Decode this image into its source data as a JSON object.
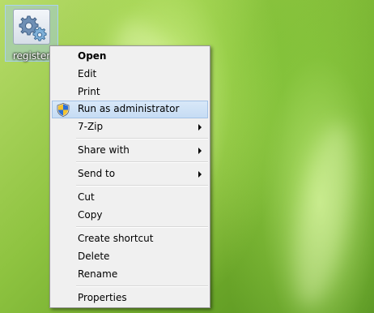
{
  "desktop": {
    "icon": {
      "label": "register",
      "icon": "gear-icon"
    }
  },
  "context_menu": {
    "items": [
      {
        "label": "Open",
        "bold": true
      },
      {
        "label": "Edit"
      },
      {
        "label": "Print"
      },
      {
        "label": "Run as administrator",
        "icon": "uac-shield-icon",
        "highlighted": true
      },
      {
        "label": "7-Zip",
        "submenu": true
      },
      {
        "label": "Share with",
        "submenu": true
      },
      {
        "label": "Send to",
        "submenu": true
      },
      {
        "label": "Cut"
      },
      {
        "label": "Copy"
      },
      {
        "label": "Create shortcut"
      },
      {
        "label": "Delete"
      },
      {
        "label": "Rename"
      },
      {
        "label": "Properties"
      }
    ]
  },
  "colors": {
    "menu_background": "#f0f0f0",
    "highlight": "#c6dcf4",
    "highlight_border": "#a4c2e6"
  }
}
